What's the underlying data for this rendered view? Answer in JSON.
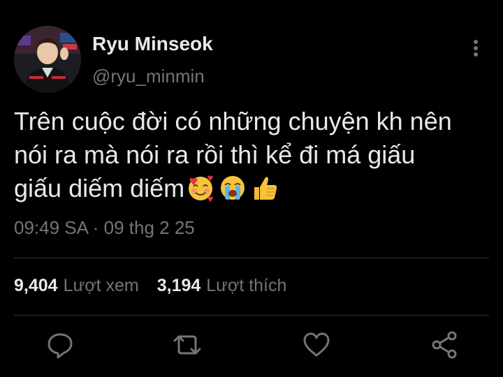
{
  "author": {
    "display_name": "Ryu Minseok",
    "handle": "@ryu_minmin",
    "avatar_icon": "profile-photo"
  },
  "tweet": {
    "text": "Trên cuộc đời có những chuyện kh nên\nnói ra mà nói ra rồi thì kể đi má giấu\ngiấu diếm diếm",
    "emojis": [
      "smiling-face-with-hearts",
      "loudly-crying-face",
      "thumbs-up"
    ],
    "timestamp": "09:49 SA · 09 thg 2 25"
  },
  "stats": {
    "views_count": "9,404",
    "views_label": "Lượt xem",
    "likes_count": "3,194",
    "likes_label": "Lượt thích"
  },
  "actions": [
    "reply-icon",
    "retweet-icon",
    "like-icon",
    "share-icon"
  ],
  "colors": {
    "background": "#000000",
    "primary_text": "#e7e9ea",
    "secondary_text": "#71767b",
    "divider": "#2f3336"
  }
}
